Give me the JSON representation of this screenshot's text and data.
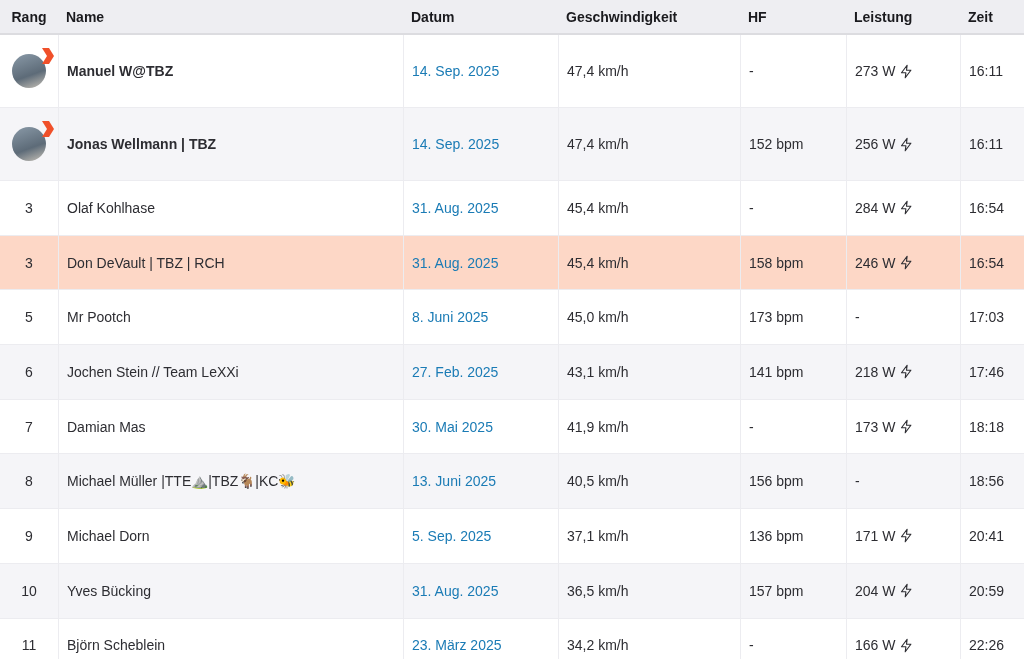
{
  "table": {
    "columns": [
      "Rang",
      "Name",
      "Datum",
      "Geschwindigkeit",
      "HF",
      "Leistung",
      "Zeit"
    ],
    "rows": [
      {
        "kind": "avatar",
        "name": "Manuel W@TBZ",
        "date": "14. Sep. 2025",
        "speed": "47,4 km/h",
        "hr": "-",
        "power": "273 W",
        "power_icon": true,
        "time": "16:11",
        "selected": false
      },
      {
        "kind": "avatar",
        "name": "Jonas Wellmann | TBZ",
        "date": "14. Sep. 2025",
        "speed": "47,4 km/h",
        "hr": "152 bpm",
        "power": "256 W",
        "power_icon": true,
        "time": "16:11",
        "selected": false
      },
      {
        "kind": "number",
        "rank": "3",
        "name": "Olaf Kohlhase",
        "date": "31. Aug. 2025",
        "speed": "45,4 km/h",
        "hr": "-",
        "power": "284 W",
        "power_icon": true,
        "time": "16:54",
        "selected": false
      },
      {
        "kind": "number",
        "rank": "3",
        "name": "Don DeVault | TBZ | RCH",
        "date": "31. Aug. 2025",
        "speed": "45,4 km/h",
        "hr": "158 bpm",
        "power": "246 W",
        "power_icon": true,
        "time": "16:54",
        "selected": true
      },
      {
        "kind": "number",
        "rank": "5",
        "name": "Mr Pootch",
        "date": "8. Juni 2025",
        "speed": "45,0 km/h",
        "hr": "173 bpm",
        "power": "-",
        "power_icon": false,
        "time": "17:03",
        "selected": false
      },
      {
        "kind": "number",
        "rank": "6",
        "name": "Jochen Stein // Team LeXXi",
        "date": "27. Feb. 2025",
        "speed": "43,1 km/h",
        "hr": "141 bpm",
        "power": "218 W",
        "power_icon": true,
        "time": "17:46",
        "selected": false
      },
      {
        "kind": "number",
        "rank": "7",
        "name": "Damian Mas",
        "date": "30. Mai 2025",
        "speed": "41,9 km/h",
        "hr": "-",
        "power": "173 W",
        "power_icon": true,
        "time": "18:18",
        "selected": false
      },
      {
        "kind": "number",
        "rank": "8",
        "name": "Michael Müller |TTE⛰️|TBZ🐐|KC🐝",
        "date": "13. Juni 2025",
        "speed": "40,5 km/h",
        "hr": "156 bpm",
        "power": "-",
        "power_icon": false,
        "time": "18:56",
        "selected": false
      },
      {
        "kind": "number",
        "rank": "9",
        "name": "Michael Dorn",
        "date": "5. Sep. 2025",
        "speed": "37,1 km/h",
        "hr": "136 bpm",
        "power": "171 W",
        "power_icon": true,
        "time": "20:41",
        "selected": false
      },
      {
        "kind": "number",
        "rank": "10",
        "name": "Yves Bücking",
        "date": "31. Aug. 2025",
        "speed": "36,5 km/h",
        "hr": "157 bpm",
        "power": "204 W",
        "power_icon": true,
        "time": "20:59",
        "selected": false
      },
      {
        "kind": "number",
        "rank": "11",
        "name": "Björn Scheblein",
        "date": "23. März 2025",
        "speed": "34,2 km/h",
        "hr": "-",
        "power": "166 W",
        "power_icon": true,
        "time": "22:26",
        "selected": false
      }
    ]
  }
}
